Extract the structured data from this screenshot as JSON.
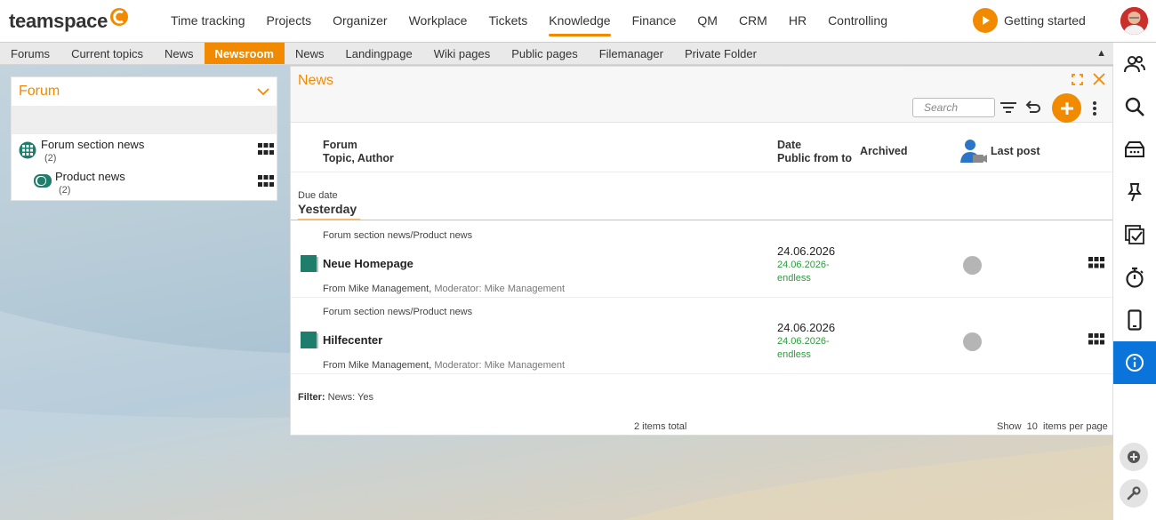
{
  "app": {
    "logo": "teamspace"
  },
  "topnav": {
    "items": [
      {
        "label": "Time tracking"
      },
      {
        "label": "Projects"
      },
      {
        "label": "Organizer"
      },
      {
        "label": "Workplace"
      },
      {
        "label": "Tickets"
      },
      {
        "label": "Knowledge",
        "active": true
      },
      {
        "label": "Finance"
      },
      {
        "label": "QM"
      },
      {
        "label": "CRM"
      },
      {
        "label": "HR"
      },
      {
        "label": "Controlling"
      }
    ],
    "getting_started": "Getting started"
  },
  "subnav": {
    "items": [
      {
        "label": "Forums"
      },
      {
        "label": "Current topics"
      },
      {
        "label": "News"
      },
      {
        "label": "Newsroom",
        "active": true
      },
      {
        "label": "News"
      },
      {
        "label": "Landingpage"
      },
      {
        "label": "Wiki pages"
      },
      {
        "label": "Public pages"
      },
      {
        "label": "Filemanager"
      },
      {
        "label": "Private Folder"
      }
    ],
    "collapse_icon": "▲"
  },
  "forum_panel": {
    "title": "Forum",
    "items": [
      {
        "label": "Forum section news",
        "count": "(2)"
      },
      {
        "label": "Product news",
        "count": "(2)"
      }
    ]
  },
  "news_panel": {
    "title": "News",
    "search_placeholder": "Search",
    "columns": {
      "forum": "Forum",
      "topic_author": "Topic, Author",
      "date": "Date",
      "public_from_to": "Public from to",
      "archived": "Archived",
      "last_post": "Last post"
    },
    "group": {
      "label": "Due date",
      "value": "Yesterday"
    },
    "rows": [
      {
        "path": "Forum section news/Product news",
        "title": "Neue Homepage",
        "from": "From Mike Management,",
        "moderator": "Moderator: Mike Management",
        "date": "24.06.2026",
        "public_from": "24.06.2026-",
        "public_to": "endless"
      },
      {
        "path": "Forum section news/Product news",
        "title": "Hilfecenter",
        "from": "From Mike Management,",
        "moderator": "Moderator: Mike Management",
        "date": "24.06.2026",
        "public_from": "24.06.2026-",
        "public_to": "endless"
      }
    ],
    "filter_label": "Filter:",
    "filter_value": "News: Yes",
    "total": "2 items total",
    "show_label": "Show",
    "per_page_value": "10",
    "per_page_label": "items per page"
  },
  "colors": {
    "accent": "#f28a00",
    "active_blue": "#0a74da",
    "green": "#2e9b3e",
    "teal": "#1f7d6c"
  },
  "rightbar": {
    "icons": [
      "users-icon",
      "search-icon",
      "inbox-icon",
      "pin-icon",
      "tasks-icon",
      "stopwatch-icon",
      "mobile-icon",
      "info-icon",
      "add-circle-icon",
      "wrench-icon"
    ]
  }
}
